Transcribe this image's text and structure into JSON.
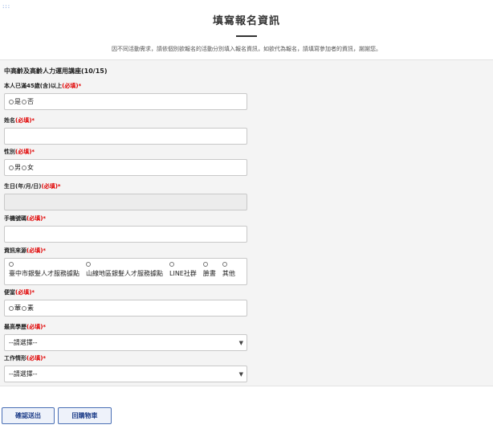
{
  "corner_mark": ":::",
  "header": {
    "title": "填寫報名資訊",
    "subtitle": "因不同活動需求，請依個別欲報名的活動分別填入報名資訊，如欲代為報名，請填寫參加者的資訊，謝謝您。"
  },
  "form": {
    "course_title": "中高齡及高齡人力運用講座(10/15)",
    "required_text": "(必填)",
    "age": {
      "label": "本人已滿45歲(含)以上",
      "options": [
        "是",
        "否"
      ]
    },
    "name": {
      "label": "姓名",
      "value": ""
    },
    "gender": {
      "label": "性別",
      "options": [
        "男",
        "女"
      ]
    },
    "birthday": {
      "label": "生日(年/月/日)",
      "value": ""
    },
    "phone": {
      "label": "手機號碼",
      "value": ""
    },
    "source": {
      "label": "資訊來源",
      "options": [
        "臺中市銀髮人才服務據點",
        "山線地區銀髮人才服務據點",
        "LINE社群",
        "臉書",
        "其他"
      ]
    },
    "diet": {
      "label": "便當",
      "options": [
        "葷",
        "素"
      ]
    },
    "education": {
      "label": "最高學歷",
      "selected": "--請選擇--"
    },
    "employment": {
      "label": "工作情形",
      "selected": "--請選擇--"
    }
  },
  "actions": {
    "submit_label": "確認送出",
    "back_label": "回購物車"
  },
  "colors": {
    "required": "#e00000",
    "button_border": "#4a6fb5",
    "button_text": "#1f3f8a",
    "panel_bg": "#f4f4f4"
  }
}
